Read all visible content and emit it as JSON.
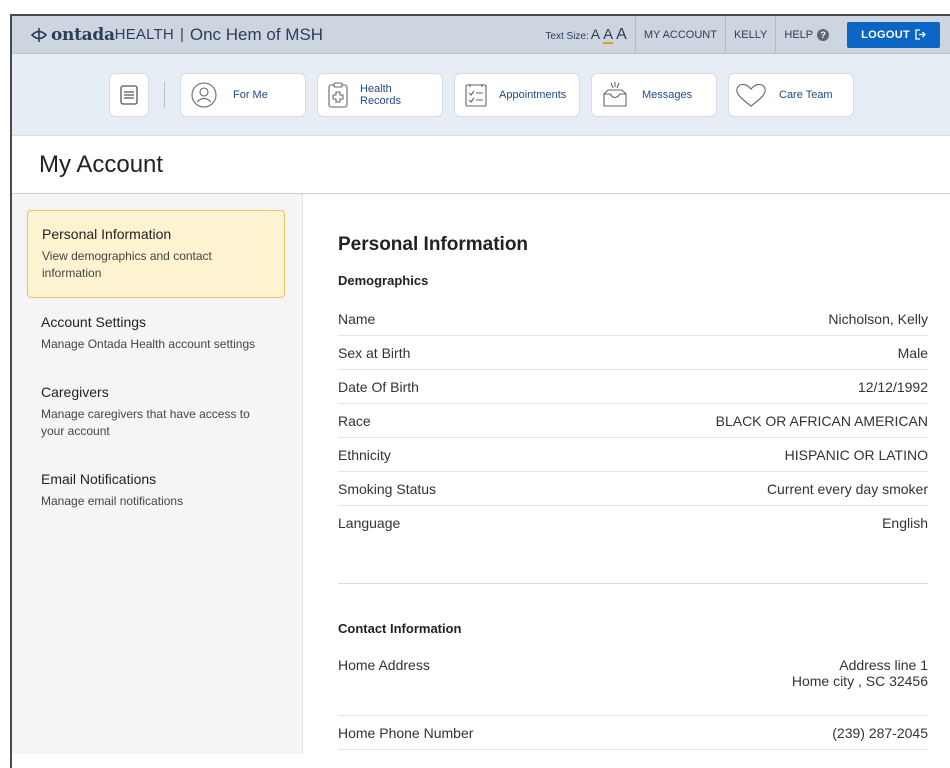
{
  "header": {
    "brand_ontada": "ontada",
    "brand_health": "HEALTH",
    "separator": "|",
    "org_name": "Onc Hem of MSH",
    "text_size_label": "Text Size:",
    "text_size_options": [
      "A",
      "A",
      "A"
    ],
    "my_account": "MY ACCOUNT",
    "user": "KELLY",
    "help": "HELP",
    "help_glyph": "?",
    "logout": "LOGOUT"
  },
  "tiles": [
    {
      "label": "For Me",
      "icon": "person-icon"
    },
    {
      "label": "Health Records",
      "icon": "clipboard-cross-icon"
    },
    {
      "label": "Appointments",
      "icon": "checklist-icon"
    },
    {
      "label": "Messages",
      "icon": "inbox-icon"
    },
    {
      "label": "Care Team",
      "icon": "heart-icon"
    }
  ],
  "page_title": "My Account",
  "sidebar": {
    "items": [
      {
        "title": "Personal Information",
        "desc": "View demographics and contact information",
        "active": true
      },
      {
        "title": "Account Settings",
        "desc": "Manage Ontada Health account settings",
        "active": false
      },
      {
        "title": "Caregivers",
        "desc": "Manage caregivers that have access to your account",
        "active": false
      },
      {
        "title": "Email Notifications",
        "desc": "Manage email notifications",
        "active": false
      }
    ]
  },
  "main": {
    "heading": "Personal Information",
    "demographics": {
      "title": "Demographics",
      "rows": [
        {
          "label": "Name",
          "value": "Nicholson, Kelly"
        },
        {
          "label": "Sex at Birth",
          "value": "Male"
        },
        {
          "label": "Date Of Birth",
          "value": "12/12/1992"
        },
        {
          "label": "Race",
          "value": "BLACK OR AFRICAN AMERICAN"
        },
        {
          "label": "Ethnicity",
          "value": "HISPANIC OR LATINO"
        },
        {
          "label": "Smoking Status",
          "value": "Current every day smoker"
        },
        {
          "label": "Language",
          "value": "English"
        }
      ]
    },
    "contact": {
      "title": "Contact Information",
      "home_address": {
        "label": "Home Address",
        "line1": "Address line 1",
        "line2": "Home city , SC 32456"
      },
      "home_phone": {
        "label": "Home Phone Number",
        "value": "(239) 287-2045"
      }
    }
  },
  "colors": {
    "topbar": "#cdd6e0",
    "tilebar": "#e6edf4",
    "logout": "#0a66c2",
    "active_bg": "#fdf3d1",
    "active_border": "#e6c45f",
    "brand_text": "#2d3e57"
  }
}
